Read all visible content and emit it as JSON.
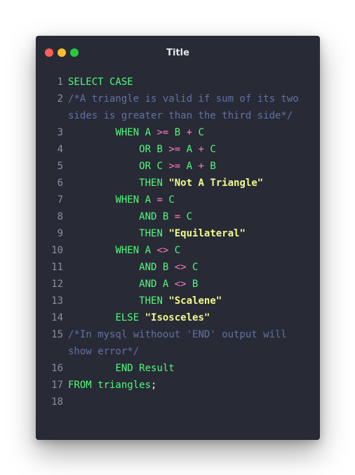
{
  "window": {
    "title": "Title",
    "controls": {
      "close": "red-dot",
      "minimize": "yellow-dot",
      "maximize": "green-dot"
    }
  },
  "colors": {
    "background": "#282a36",
    "keyword": "#50fa7b",
    "operator": "#ff79c6",
    "string": "#f1fa8c",
    "comment": "#6272a4",
    "line_number": "#8b8fa3"
  },
  "code": {
    "lines": [
      {
        "num": "1",
        "tokens": [
          {
            "t": "SELECT CASE",
            "c": "kw"
          }
        ]
      },
      {
        "num": "2",
        "tokens": [
          {
            "t": "/*A triangle is valid if sum of its two sides is greater than the third side*/",
            "c": "cm"
          }
        ]
      },
      {
        "num": "3",
        "tokens": [
          {
            "t": "        ",
            "c": "t"
          },
          {
            "t": "WHEN",
            "c": "kw"
          },
          {
            "t": " A ",
            "c": "kw"
          },
          {
            "t": ">=",
            "c": "op"
          },
          {
            "t": " B ",
            "c": "kw"
          },
          {
            "t": "+",
            "c": "op"
          },
          {
            "t": " C",
            "c": "kw"
          }
        ]
      },
      {
        "num": "4",
        "tokens": [
          {
            "t": "            ",
            "c": "t"
          },
          {
            "t": "OR",
            "c": "kw"
          },
          {
            "t": " B ",
            "c": "kw"
          },
          {
            "t": ">=",
            "c": "op"
          },
          {
            "t": " A ",
            "c": "kw"
          },
          {
            "t": "+",
            "c": "op"
          },
          {
            "t": " C",
            "c": "kw"
          }
        ]
      },
      {
        "num": "5",
        "tokens": [
          {
            "t": "            ",
            "c": "t"
          },
          {
            "t": "OR",
            "c": "kw"
          },
          {
            "t": " C ",
            "c": "kw"
          },
          {
            "t": ">=",
            "c": "op"
          },
          {
            "t": " A ",
            "c": "kw"
          },
          {
            "t": "+",
            "c": "op"
          },
          {
            "t": " B",
            "c": "kw"
          }
        ]
      },
      {
        "num": "6",
        "tokens": [
          {
            "t": "            ",
            "c": "t"
          },
          {
            "t": "THEN",
            "c": "kw"
          },
          {
            "t": " ",
            "c": "t"
          },
          {
            "t": "\"Not A Triangle\"",
            "c": "str"
          }
        ]
      },
      {
        "num": "7",
        "tokens": [
          {
            "t": "        ",
            "c": "t"
          },
          {
            "t": "WHEN",
            "c": "kw"
          },
          {
            "t": " A ",
            "c": "kw"
          },
          {
            "t": "=",
            "c": "op"
          },
          {
            "t": " C",
            "c": "kw"
          }
        ]
      },
      {
        "num": "8",
        "tokens": [
          {
            "t": "            ",
            "c": "t"
          },
          {
            "t": "AND",
            "c": "kw"
          },
          {
            "t": " B ",
            "c": "kw"
          },
          {
            "t": "=",
            "c": "op"
          },
          {
            "t": " C",
            "c": "kw"
          }
        ]
      },
      {
        "num": "9",
        "tokens": [
          {
            "t": "            ",
            "c": "t"
          },
          {
            "t": "THEN",
            "c": "kw"
          },
          {
            "t": " ",
            "c": "t"
          },
          {
            "t": "\"Equilateral\"",
            "c": "str"
          }
        ]
      },
      {
        "num": "10",
        "tokens": [
          {
            "t": "        ",
            "c": "t"
          },
          {
            "t": "WHEN",
            "c": "kw"
          },
          {
            "t": " A ",
            "c": "kw"
          },
          {
            "t": "<>",
            "c": "op"
          },
          {
            "t": " C",
            "c": "kw"
          }
        ]
      },
      {
        "num": "11",
        "tokens": [
          {
            "t": "            ",
            "c": "t"
          },
          {
            "t": "AND",
            "c": "kw"
          },
          {
            "t": " B ",
            "c": "kw"
          },
          {
            "t": "<>",
            "c": "op"
          },
          {
            "t": " C",
            "c": "kw"
          }
        ]
      },
      {
        "num": "12",
        "tokens": [
          {
            "t": "            ",
            "c": "t"
          },
          {
            "t": "AND",
            "c": "kw"
          },
          {
            "t": " A ",
            "c": "kw"
          },
          {
            "t": "<>",
            "c": "op"
          },
          {
            "t": " B",
            "c": "kw"
          }
        ]
      },
      {
        "num": "13",
        "tokens": [
          {
            "t": "            ",
            "c": "t"
          },
          {
            "t": "THEN",
            "c": "kw"
          },
          {
            "t": " ",
            "c": "t"
          },
          {
            "t": "\"Scalene\"",
            "c": "str"
          }
        ]
      },
      {
        "num": "14",
        "tokens": [
          {
            "t": "        ",
            "c": "t"
          },
          {
            "t": "ELSE",
            "c": "kw"
          },
          {
            "t": " ",
            "c": "t"
          },
          {
            "t": "\"Isosceles\"",
            "c": "str"
          }
        ]
      },
      {
        "num": "15",
        "tokens": [
          {
            "t": "/*In mysql withoout 'END' output will show error*/",
            "c": "cm"
          }
        ]
      },
      {
        "num": "16",
        "tokens": [
          {
            "t": "        ",
            "c": "t"
          },
          {
            "t": "END Result",
            "c": "kw"
          }
        ]
      },
      {
        "num": "17",
        "tokens": [
          {
            "t": "FROM",
            "c": "kw"
          },
          {
            "t": " triangles",
            "c": "id"
          },
          {
            "t": ";",
            "c": "pn"
          }
        ]
      },
      {
        "num": "18",
        "tokens": []
      }
    ]
  }
}
